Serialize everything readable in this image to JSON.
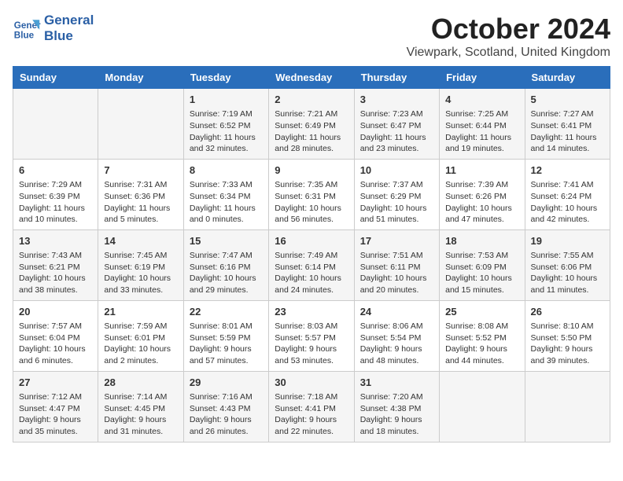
{
  "logo": {
    "line1": "General",
    "line2": "Blue"
  },
  "title": "October 2024",
  "subtitle": "Viewpark, Scotland, United Kingdom",
  "days_of_week": [
    "Sunday",
    "Monday",
    "Tuesday",
    "Wednesday",
    "Thursday",
    "Friday",
    "Saturday"
  ],
  "weeks": [
    [
      {
        "day": "",
        "content": ""
      },
      {
        "day": "",
        "content": ""
      },
      {
        "day": "1",
        "content": "Sunrise: 7:19 AM\nSunset: 6:52 PM\nDaylight: 11 hours and 32 minutes."
      },
      {
        "day": "2",
        "content": "Sunrise: 7:21 AM\nSunset: 6:49 PM\nDaylight: 11 hours and 28 minutes."
      },
      {
        "day": "3",
        "content": "Sunrise: 7:23 AM\nSunset: 6:47 PM\nDaylight: 11 hours and 23 minutes."
      },
      {
        "day": "4",
        "content": "Sunrise: 7:25 AM\nSunset: 6:44 PM\nDaylight: 11 hours and 19 minutes."
      },
      {
        "day": "5",
        "content": "Sunrise: 7:27 AM\nSunset: 6:41 PM\nDaylight: 11 hours and 14 minutes."
      }
    ],
    [
      {
        "day": "6",
        "content": "Sunrise: 7:29 AM\nSunset: 6:39 PM\nDaylight: 11 hours and 10 minutes."
      },
      {
        "day": "7",
        "content": "Sunrise: 7:31 AM\nSunset: 6:36 PM\nDaylight: 11 hours and 5 minutes."
      },
      {
        "day": "8",
        "content": "Sunrise: 7:33 AM\nSunset: 6:34 PM\nDaylight: 11 hours and 0 minutes."
      },
      {
        "day": "9",
        "content": "Sunrise: 7:35 AM\nSunset: 6:31 PM\nDaylight: 10 hours and 56 minutes."
      },
      {
        "day": "10",
        "content": "Sunrise: 7:37 AM\nSunset: 6:29 PM\nDaylight: 10 hours and 51 minutes."
      },
      {
        "day": "11",
        "content": "Sunrise: 7:39 AM\nSunset: 6:26 PM\nDaylight: 10 hours and 47 minutes."
      },
      {
        "day": "12",
        "content": "Sunrise: 7:41 AM\nSunset: 6:24 PM\nDaylight: 10 hours and 42 minutes."
      }
    ],
    [
      {
        "day": "13",
        "content": "Sunrise: 7:43 AM\nSunset: 6:21 PM\nDaylight: 10 hours and 38 minutes."
      },
      {
        "day": "14",
        "content": "Sunrise: 7:45 AM\nSunset: 6:19 PM\nDaylight: 10 hours and 33 minutes."
      },
      {
        "day": "15",
        "content": "Sunrise: 7:47 AM\nSunset: 6:16 PM\nDaylight: 10 hours and 29 minutes."
      },
      {
        "day": "16",
        "content": "Sunrise: 7:49 AM\nSunset: 6:14 PM\nDaylight: 10 hours and 24 minutes."
      },
      {
        "day": "17",
        "content": "Sunrise: 7:51 AM\nSunset: 6:11 PM\nDaylight: 10 hours and 20 minutes."
      },
      {
        "day": "18",
        "content": "Sunrise: 7:53 AM\nSunset: 6:09 PM\nDaylight: 10 hours and 15 minutes."
      },
      {
        "day": "19",
        "content": "Sunrise: 7:55 AM\nSunset: 6:06 PM\nDaylight: 10 hours and 11 minutes."
      }
    ],
    [
      {
        "day": "20",
        "content": "Sunrise: 7:57 AM\nSunset: 6:04 PM\nDaylight: 10 hours and 6 minutes."
      },
      {
        "day": "21",
        "content": "Sunrise: 7:59 AM\nSunset: 6:01 PM\nDaylight: 10 hours and 2 minutes."
      },
      {
        "day": "22",
        "content": "Sunrise: 8:01 AM\nSunset: 5:59 PM\nDaylight: 9 hours and 57 minutes."
      },
      {
        "day": "23",
        "content": "Sunrise: 8:03 AM\nSunset: 5:57 PM\nDaylight: 9 hours and 53 minutes."
      },
      {
        "day": "24",
        "content": "Sunrise: 8:06 AM\nSunset: 5:54 PM\nDaylight: 9 hours and 48 minutes."
      },
      {
        "day": "25",
        "content": "Sunrise: 8:08 AM\nSunset: 5:52 PM\nDaylight: 9 hours and 44 minutes."
      },
      {
        "day": "26",
        "content": "Sunrise: 8:10 AM\nSunset: 5:50 PM\nDaylight: 9 hours and 39 minutes."
      }
    ],
    [
      {
        "day": "27",
        "content": "Sunrise: 7:12 AM\nSunset: 4:47 PM\nDaylight: 9 hours and 35 minutes."
      },
      {
        "day": "28",
        "content": "Sunrise: 7:14 AM\nSunset: 4:45 PM\nDaylight: 9 hours and 31 minutes."
      },
      {
        "day": "29",
        "content": "Sunrise: 7:16 AM\nSunset: 4:43 PM\nDaylight: 9 hours and 26 minutes."
      },
      {
        "day": "30",
        "content": "Sunrise: 7:18 AM\nSunset: 4:41 PM\nDaylight: 9 hours and 22 minutes."
      },
      {
        "day": "31",
        "content": "Sunrise: 7:20 AM\nSunset: 4:38 PM\nDaylight: 9 hours and 18 minutes."
      },
      {
        "day": "",
        "content": ""
      },
      {
        "day": "",
        "content": ""
      }
    ]
  ]
}
